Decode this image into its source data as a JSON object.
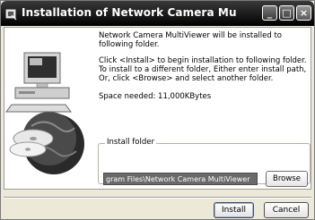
{
  "window": {
    "title": "Installation of Network Camera MultiViewer - Select i...",
    "min_glyph": "_",
    "max_glyph": "□",
    "close_glyph": "×"
  },
  "info": {
    "line1": "Network Camera MultiViewer will be installed to following folder.",
    "line2": "Click <Install> to begin installation to following folder. To install to a different folder, Either enter install path, Or, click <Browse> and select another folder.",
    "space_needed": "Space needed: 11,000KBytes"
  },
  "install_folder": {
    "label": "Install folder",
    "path": "gram Files\\Network Camera MultiViewer",
    "browse_label": "Browse"
  },
  "buttons": {
    "install_label": "Install",
    "cancel_label": "Cancel"
  },
  "icons": {
    "title": "installer-icon",
    "graphic": "computer-disc-globe-illustration"
  }
}
